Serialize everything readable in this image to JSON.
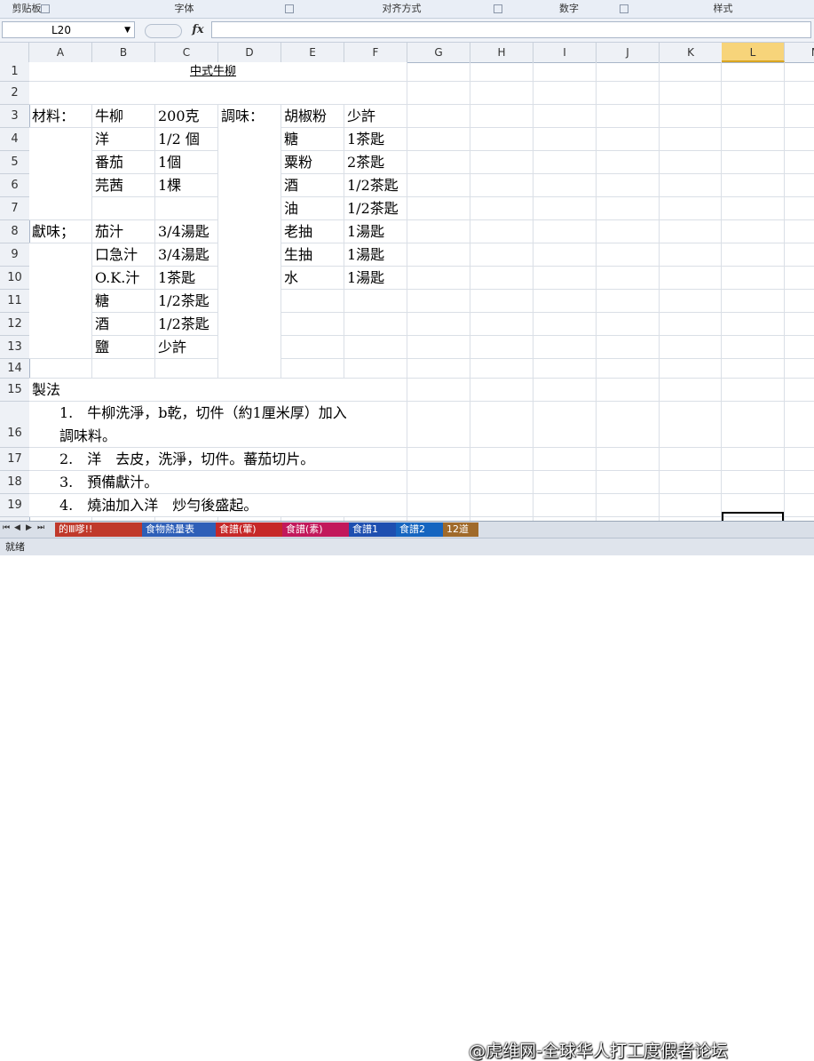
{
  "ribbon": {
    "groups": [
      "剪贴板",
      "字体",
      "对齐方式",
      "数字",
      "样式"
    ]
  },
  "formula_bar": {
    "name_box": "L20",
    "fx_label": "fx",
    "formula": ""
  },
  "columns": [
    "A",
    "B",
    "C",
    "D",
    "E",
    "F",
    "G",
    "H",
    "I",
    "J",
    "K",
    "L",
    "M"
  ],
  "selected_column": "L",
  "rows": [
    "1",
    "2",
    "3",
    "4",
    "5",
    "6",
    "7",
    "8",
    "9",
    "10",
    "11",
    "12",
    "13",
    "14",
    "15",
    "16",
    "17",
    "18",
    "19"
  ],
  "sheet": {
    "title": "中式牛柳",
    "cells": [
      {
        "row": 3,
        "col": "A",
        "text": "材料："
      },
      {
        "row": 3,
        "col": "B",
        "text": "牛柳"
      },
      {
        "row": 3,
        "col": "C",
        "text": "200克"
      },
      {
        "row": 3,
        "col": "D",
        "text": "調味："
      },
      {
        "row": 3,
        "col": "E",
        "text": "胡椒粉"
      },
      {
        "row": 3,
        "col": "F",
        "text": "少許"
      },
      {
        "row": 4,
        "col": "B",
        "text": "洋"
      },
      {
        "row": 4,
        "col": "C",
        "text": "1/2 個"
      },
      {
        "row": 4,
        "col": "E",
        "text": "糖"
      },
      {
        "row": 4,
        "col": "F",
        "text": "1茶匙"
      },
      {
        "row": 5,
        "col": "B",
        "text": "番茄"
      },
      {
        "row": 5,
        "col": "C",
        "text": "1個"
      },
      {
        "row": 5,
        "col": "E",
        "text": "粟粉"
      },
      {
        "row": 5,
        "col": "F",
        "text": "2茶匙"
      },
      {
        "row": 6,
        "col": "B",
        "text": "芫茜"
      },
      {
        "row": 6,
        "col": "C",
        "text": "1棵"
      },
      {
        "row": 6,
        "col": "E",
        "text": "酒"
      },
      {
        "row": 6,
        "col": "F",
        "text": "1/2茶匙"
      },
      {
        "row": 7,
        "col": "E",
        "text": "油"
      },
      {
        "row": 7,
        "col": "F",
        "text": "1/2茶匙"
      },
      {
        "row": 8,
        "col": "A",
        "text": "獻味；"
      },
      {
        "row": 8,
        "col": "B",
        "text": "茄汁"
      },
      {
        "row": 8,
        "col": "C",
        "text": "3/4湯匙"
      },
      {
        "row": 8,
        "col": "E",
        "text": "老抽"
      },
      {
        "row": 8,
        "col": "F",
        "text": "1湯匙"
      },
      {
        "row": 9,
        "col": "B",
        "text": "口急汁"
      },
      {
        "row": 9,
        "col": "C",
        "text": "3/4湯匙"
      },
      {
        "row": 9,
        "col": "E",
        "text": "生抽"
      },
      {
        "row": 9,
        "col": "F",
        "text": "1湯匙"
      },
      {
        "row": 10,
        "col": "B",
        "text": "O.K.汁"
      },
      {
        "row": 10,
        "col": "C",
        "text": "1茶匙"
      },
      {
        "row": 10,
        "col": "E",
        "text": "水"
      },
      {
        "row": 10,
        "col": "F",
        "text": "1湯匙"
      },
      {
        "row": 11,
        "col": "B",
        "text": "糖"
      },
      {
        "row": 11,
        "col": "C",
        "text": "1/2茶匙"
      },
      {
        "row": 12,
        "col": "B",
        "text": "酒"
      },
      {
        "row": 12,
        "col": "C",
        "text": "1/2茶匙"
      },
      {
        "row": 13,
        "col": "B",
        "text": "鹽"
      },
      {
        "row": 13,
        "col": "C",
        "text": "少許"
      },
      {
        "row": 15,
        "col": "A",
        "text": "製法"
      }
    ],
    "steps": [
      {
        "row": 16,
        "line1": "1.　牛柳洗淨，b乾，切件（約1厘米厚）加入",
        "line2": "調味料。"
      },
      {
        "row": 17,
        "line1": "2.　洋　去皮，洗淨，切件。蕃茄切片。"
      },
      {
        "row": 18,
        "line1": "3.　預備獻汁。"
      },
      {
        "row": 19,
        "line1": "4.　燒油加入洋　炒勻後盛起。"
      }
    ]
  },
  "sheet_tabs": [
    {
      "label": "的Ⅲ嗲!!",
      "color": "#c0392b"
    },
    {
      "label": "食物熱量表",
      "color": "#2e5fb8"
    },
    {
      "label": "食譜(葷)",
      "color": "#c62828"
    },
    {
      "label": "食譜(素)",
      "color": "#c2185b"
    },
    {
      "label": "食譜1",
      "color": "#1e4fb0"
    },
    {
      "label": "食譜2",
      "color": "#1565c0"
    },
    {
      "label": "12道",
      "color": "#a06a2a"
    }
  ],
  "watermark": "@虎维网-全球华人打工度假者论坛",
  "status": "就绪"
}
